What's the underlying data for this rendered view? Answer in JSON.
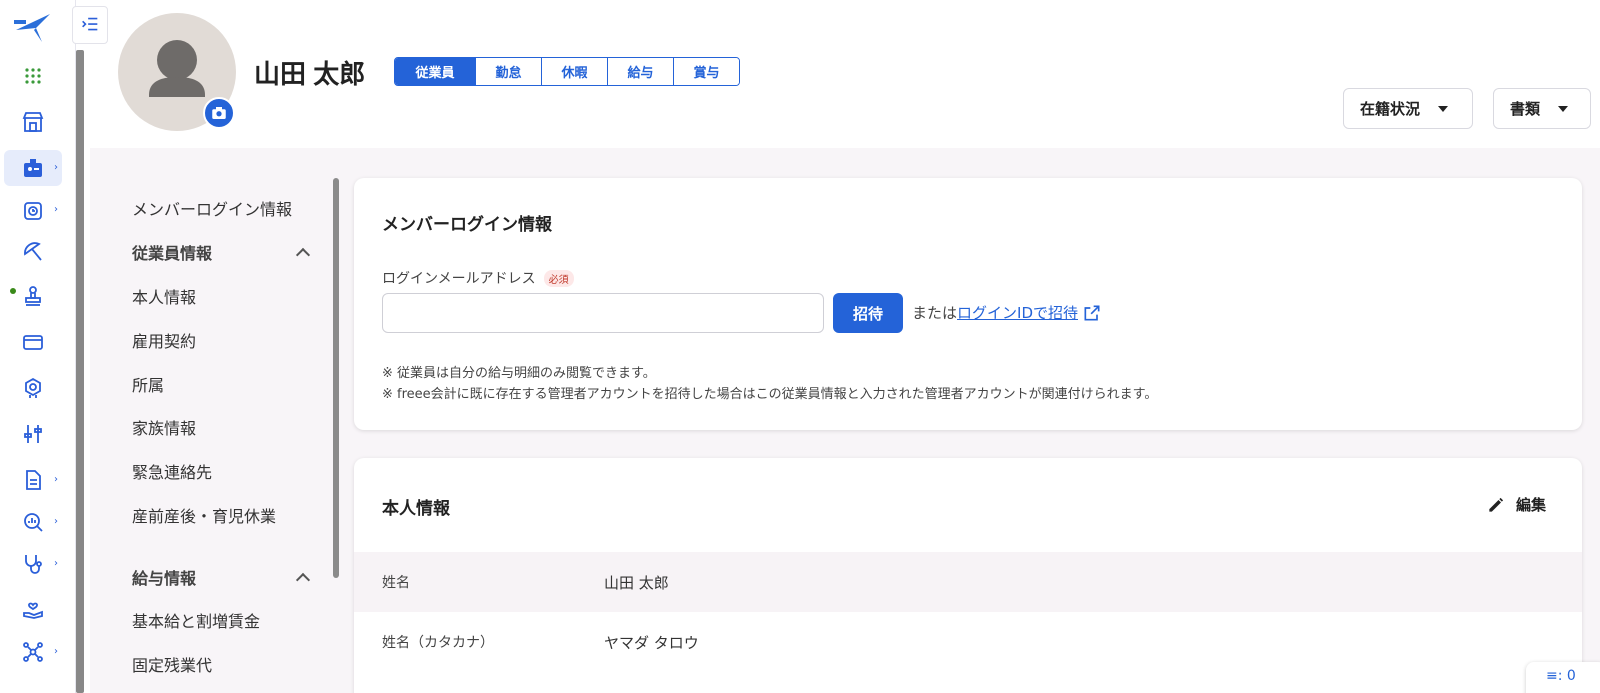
{
  "employee": {
    "name": "山田 太郎"
  },
  "tabs": [
    {
      "label": "従業員",
      "active": true
    },
    {
      "label": "勤怠",
      "active": false
    },
    {
      "label": "休暇",
      "active": false
    },
    {
      "label": "給与",
      "active": false
    },
    {
      "label": "賞与",
      "active": false
    }
  ],
  "header_buttons": {
    "status_label": "在籍状況",
    "docs_label": "書類"
  },
  "sidenav": {
    "login_info": "メンバーログイン情報",
    "group_employee": "従業員情報",
    "items_employee": [
      "本人情報",
      "雇用契約",
      "所属",
      "家族情報",
      "緊急連絡先",
      "産前産後・育児休業"
    ],
    "group_salary": "給与情報",
    "items_salary": [
      "基本給と割増賃金",
      "固定残業代"
    ]
  },
  "login_card": {
    "title": "メンバーログイン情報",
    "email_label": "ログインメールアドレス",
    "required_badge": "必須",
    "email_value": "",
    "invite_button": "招待",
    "or_text": "または",
    "invite_by_id_link": "ログインIDで招待",
    "note1": "※ 従業員は自分の給与明細のみ閲覧できます。",
    "note2": "※ freee会計に既に存在する管理者アカウントを招待した場合はこの従業員情報と入力された管理者アカウントが関連付けられます。"
  },
  "personal_card": {
    "title": "本人情報",
    "edit_label": "編集",
    "rows": [
      {
        "label": "姓名",
        "value": "山田 太郎"
      },
      {
        "label": "姓名（カタカナ）",
        "value": "ヤマダ タロウ"
      }
    ]
  },
  "float_button": "≡: 0",
  "colors": {
    "accent": "#2463d8",
    "content_bg": "#f8f5f8",
    "rail_active_bg": "#e6ecfb"
  }
}
